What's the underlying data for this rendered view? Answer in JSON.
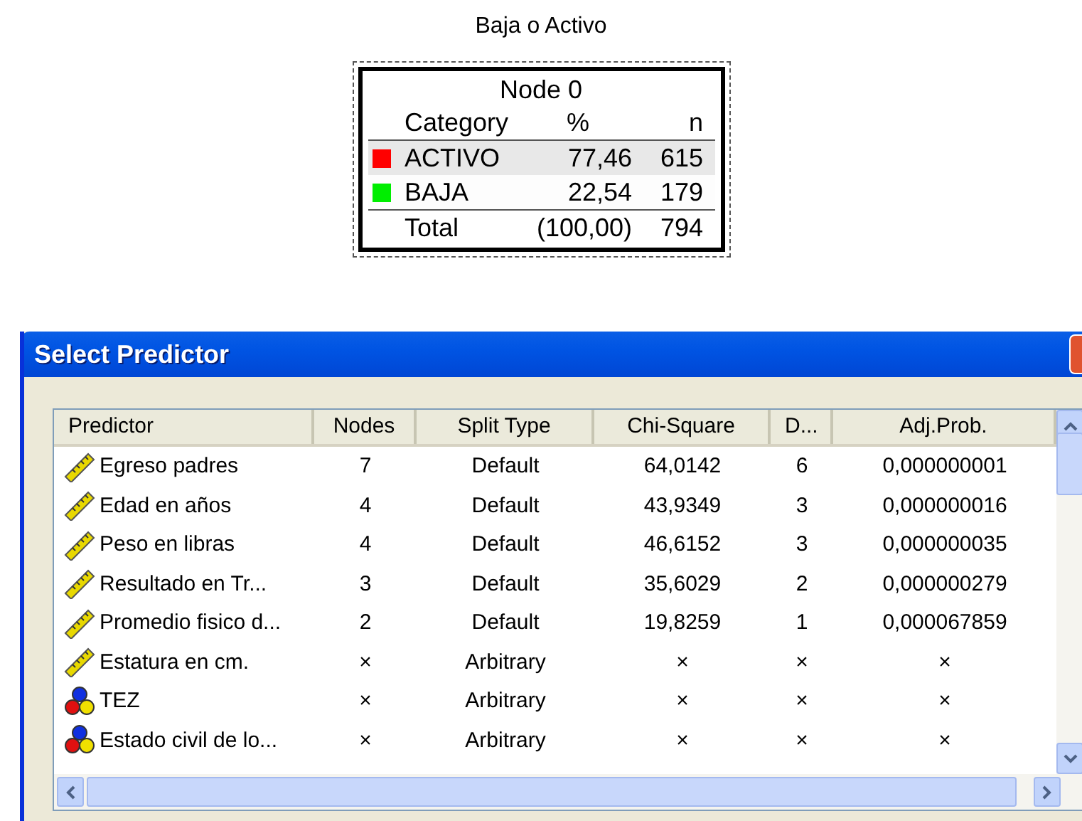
{
  "tree_title": "Baja o Activo",
  "node": {
    "title": "Node 0",
    "headers": [
      "Category",
      "%",
      "n"
    ],
    "rows": [
      {
        "category": "ACTIVO",
        "color": "#ff0000",
        "percent": "77,46",
        "n": "615",
        "shaded": true
      },
      {
        "category": "BAJA",
        "color": "#00ee00",
        "percent": "22,54",
        "n": "179",
        "shaded": false
      }
    ],
    "total": {
      "label": "Total",
      "percent": "(100,00)",
      "n": "794"
    }
  },
  "dialog": {
    "title": "Select Predictor",
    "table": {
      "columns": [
        "Predictor",
        "Nodes",
        "Split Type",
        "Chi-Square",
        "D...",
        "Adj.Prob."
      ],
      "rows": [
        {
          "kind": "scale",
          "predictor": "Egreso padres",
          "nodes": "7",
          "split_type": "Default",
          "chi_square": "64,0142",
          "d": "6",
          "adj_prob": "0,000000001"
        },
        {
          "kind": "scale",
          "predictor": "Edad en años",
          "nodes": "4",
          "split_type": "Default",
          "chi_square": "43,9349",
          "d": "3",
          "adj_prob": "0,000000016"
        },
        {
          "kind": "scale",
          "predictor": "Peso en libras",
          "nodes": "4",
          "split_type": "Default",
          "chi_square": "46,6152",
          "d": "3",
          "adj_prob": "0,000000035"
        },
        {
          "kind": "scale",
          "predictor": "Resultado en Tr...",
          "nodes": "3",
          "split_type": "Default",
          "chi_square": "35,6029",
          "d": "2",
          "adj_prob": "0,000000279"
        },
        {
          "kind": "scale",
          "predictor": "Promedio fisico d...",
          "nodes": "2",
          "split_type": "Default",
          "chi_square": "19,8259",
          "d": "1",
          "adj_prob": "0,000067859"
        },
        {
          "kind": "scale",
          "predictor": "Estatura en cm.",
          "nodes": "×",
          "split_type": "Arbitrary",
          "chi_square": "×",
          "d": "×",
          "adj_prob": "×"
        },
        {
          "kind": "nominal",
          "predictor": "TEZ",
          "nodes": "×",
          "split_type": "Arbitrary",
          "chi_square": "×",
          "d": "×",
          "adj_prob": "×"
        },
        {
          "kind": "nominal",
          "predictor": "Estado civil de lo...",
          "nodes": "×",
          "split_type": "Arbitrary",
          "chi_square": "×",
          "d": "×",
          "adj_prob": "×"
        }
      ]
    }
  }
}
